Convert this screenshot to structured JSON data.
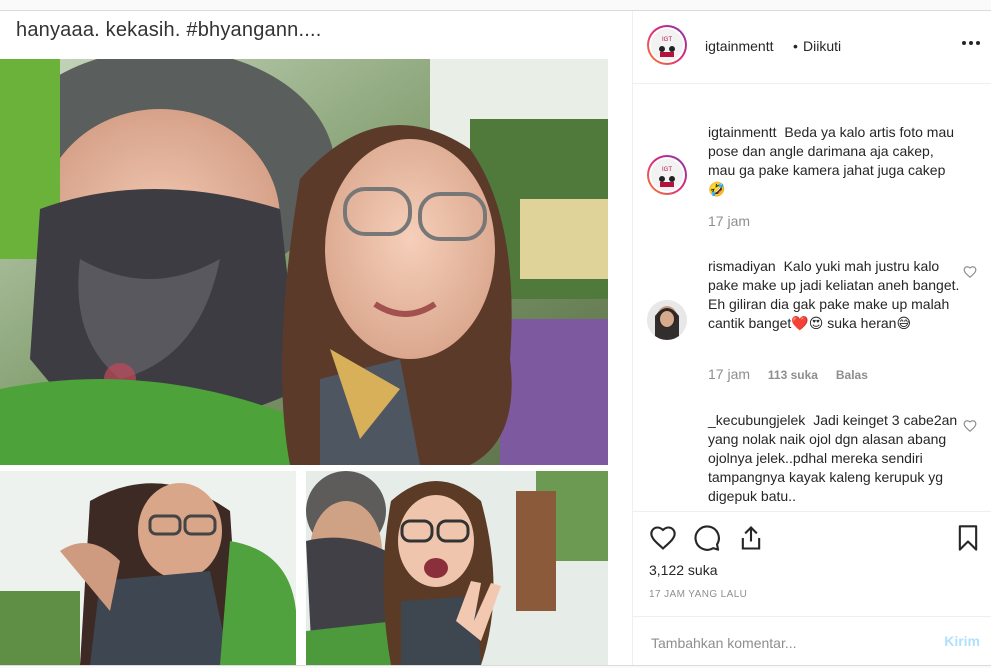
{
  "post": {
    "caption_overlay": "hanyaaa. kekasih. #bhyangann....",
    "images": [
      "photo-selfie-main",
      "photo-bottom-left",
      "photo-bottom-right"
    ]
  },
  "header": {
    "username": "igtainmentt",
    "separator": "•",
    "follow_status": "Diikuti",
    "more_icon": "more-horizontal-icon"
  },
  "comments": [
    {
      "username": "igtainmentt",
      "text": "Beda ya kalo artis foto mau pose dan angle darimana aja cakep, mau ga pake kamera jahat juga cakep 🤣",
      "time": "17 jam"
    },
    {
      "username": "rismadiyan",
      "text": "Kalo yuki mah justru kalo pake make up jadi keliatan aneh banget. Eh giliran dia gak pake make up malah cantik banget❤️😍 suka heran😅",
      "time": "17 jam",
      "likes": "113 suka",
      "reply": "Balas"
    },
    {
      "username": "_kecubungjelek",
      "text": "Jadi keinget 3 cabe2an yang nolak naik ojol dgn alasan abang ojolnya jelek..pdhal mereka sendiri tampangnya kayak kaleng kerupuk yg digepuk batu.."
    }
  ],
  "actions": {
    "like_icon": "heart-icon",
    "comment_icon": "comment-icon",
    "share_icon": "share-icon",
    "save_icon": "bookmark-icon",
    "likes_count": "3,122 suka",
    "time_ago": "17 JAM YANG LALU"
  },
  "add_comment": {
    "placeholder": "Tambahkan komentar...",
    "send_label": "Kirim"
  }
}
